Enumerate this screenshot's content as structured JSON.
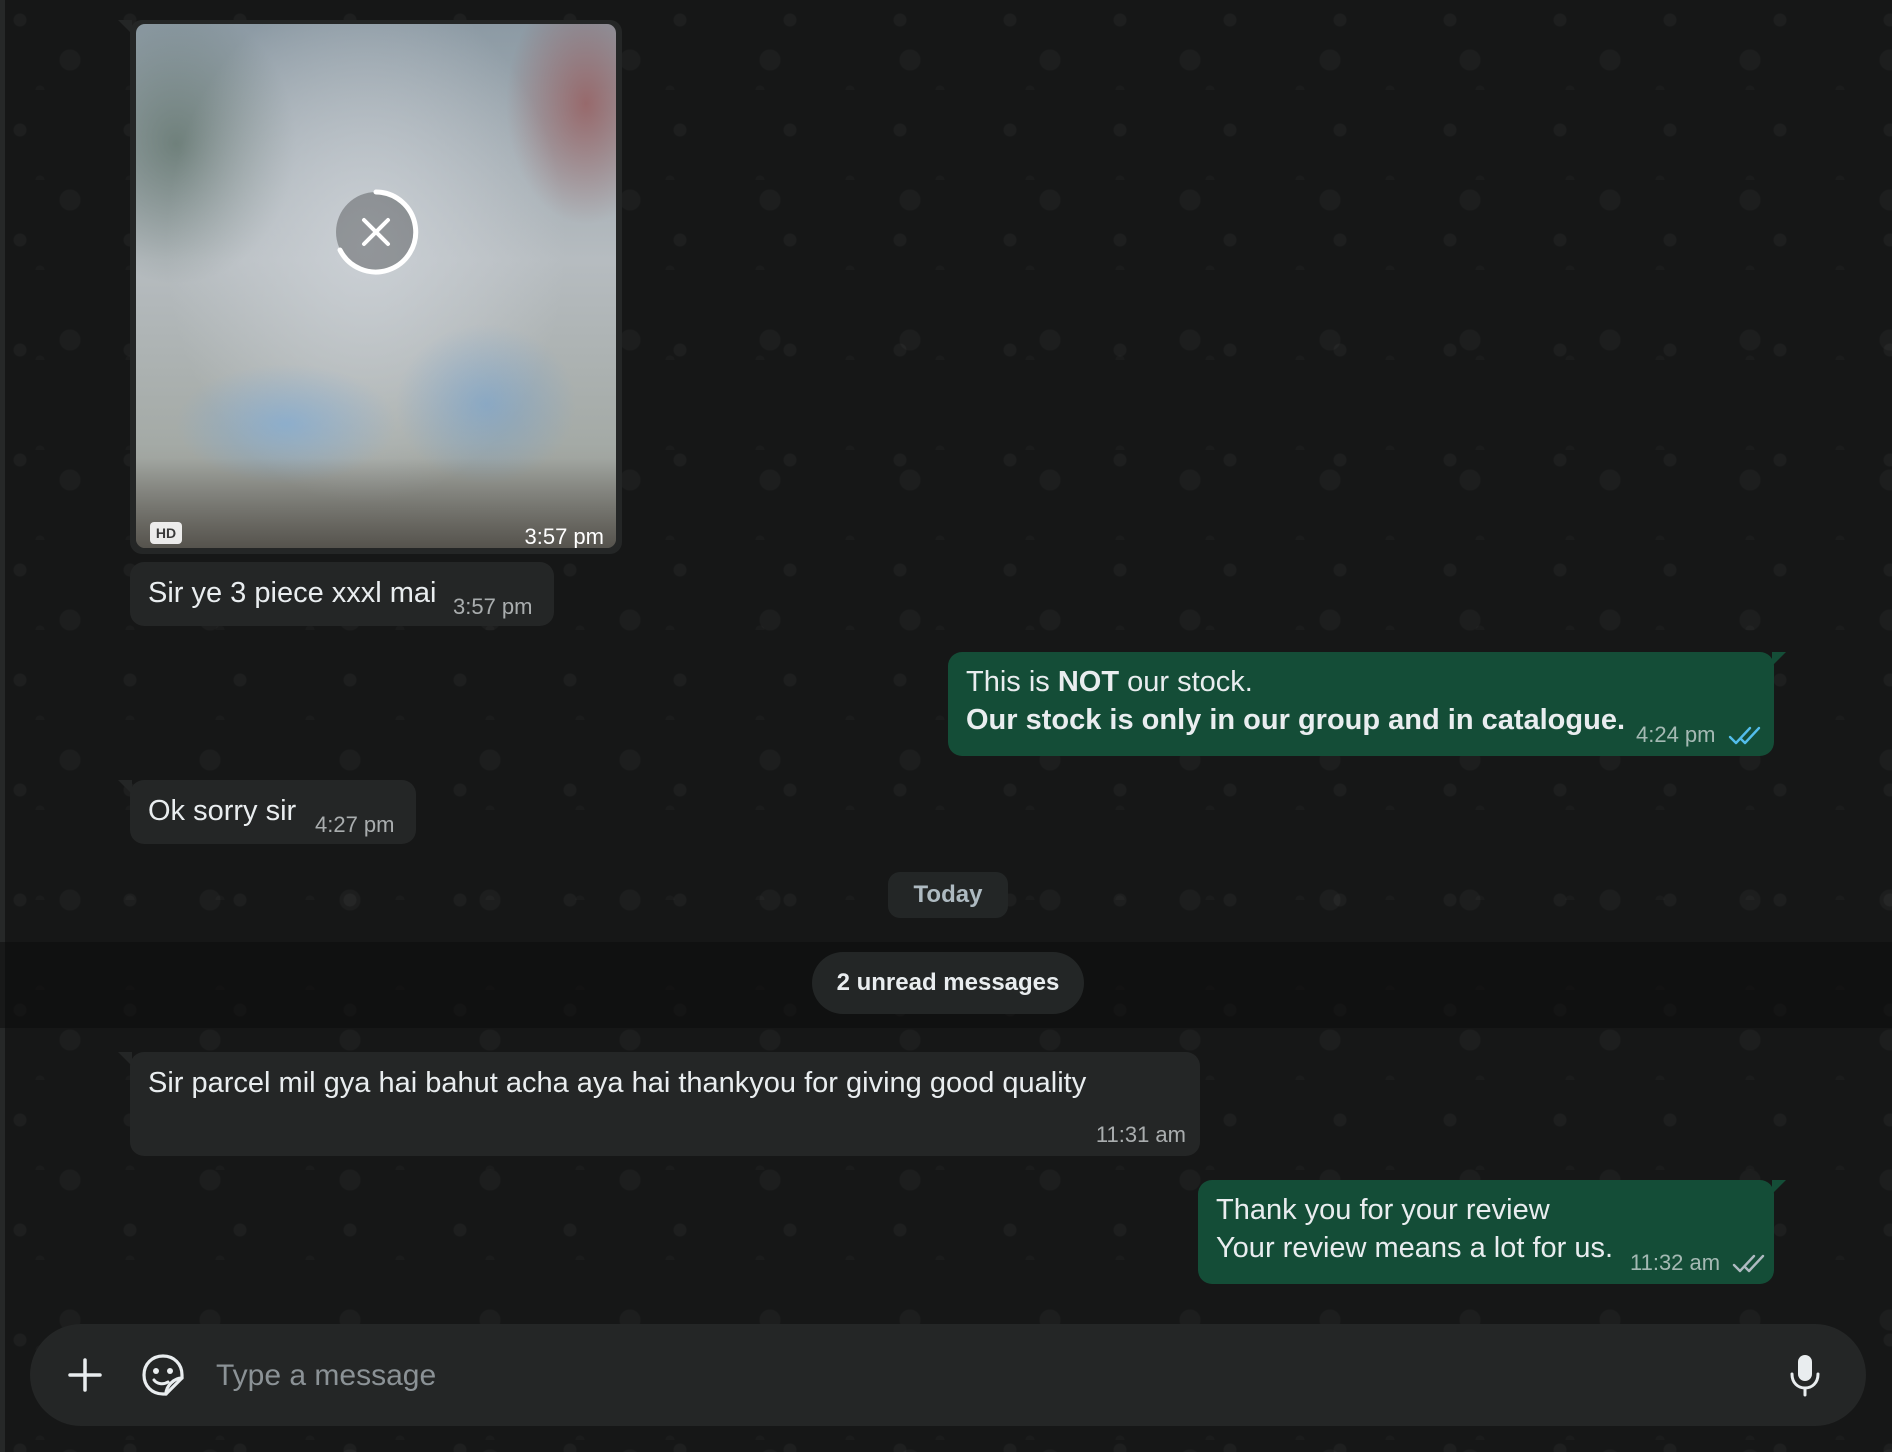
{
  "messages": {
    "image_msg": {
      "hd_badge": "HD",
      "time": "3:57 pm"
    },
    "msg1": {
      "text": "Sir ye 3 piece xxxl mai",
      "time": "3:57 pm"
    },
    "msg2": {
      "line1_pre": "This is ",
      "line1_bold": "NOT",
      "line1_post": " our stock.",
      "line2": "Our stock is only in our group and in catalogue.",
      "time": "4:24 pm"
    },
    "msg3": {
      "text": "Ok sorry sir",
      "time": "4:27 pm"
    },
    "msg4": {
      "text": "Sir parcel mil gya hai bahut acha aya hai thankyou for giving good quality",
      "time": "11:31 am"
    },
    "msg5": {
      "line1": "Thank you for your review",
      "line2": "Your review means a lot for us.",
      "time": "11:32 am"
    }
  },
  "separators": {
    "date": "Today",
    "unread": "2 unread messages"
  },
  "composer": {
    "placeholder": "Type a message"
  },
  "icons": {
    "attach": "plus-icon",
    "sticker": "sticker-icon",
    "mic": "microphone-icon",
    "read_receipt": "double-check-icon",
    "cancel_download": "close-icon"
  },
  "colors": {
    "background": "#161717",
    "incoming_bubble": "#242626",
    "outgoing_bubble": "#144d37",
    "read_tick": "#53bdeb"
  }
}
